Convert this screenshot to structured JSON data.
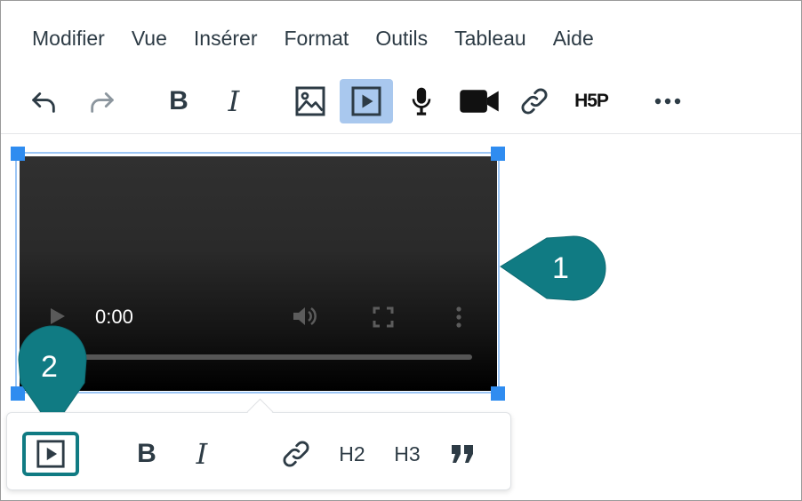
{
  "menubar": {
    "items": [
      "Modifier",
      "Vue",
      "Insérer",
      "Format",
      "Outils",
      "Tableau",
      "Aide"
    ]
  },
  "toolbar": {
    "bold_label": "B",
    "italic_label": "I",
    "h5p_label": "H5P",
    "active_button": "media-button",
    "icons": [
      "undo-icon",
      "redo-icon",
      "image-icon",
      "media-icon",
      "microphone-icon",
      "video-camera-icon",
      "link-icon",
      "more-icon"
    ]
  },
  "video": {
    "time": "0:00",
    "progress": 0
  },
  "callouts": {
    "one": "1",
    "two": "2",
    "color": "#107b83"
  },
  "context_toolbar": {
    "bold_label": "B",
    "italic_label": "I",
    "h2_label": "H2",
    "h3_label": "H3"
  },
  "colors": {
    "accent": "#107b83",
    "active_button_bg": "#a9c8ee",
    "resize_handle": "#2f8cf0",
    "icon": "#2d3b45"
  }
}
